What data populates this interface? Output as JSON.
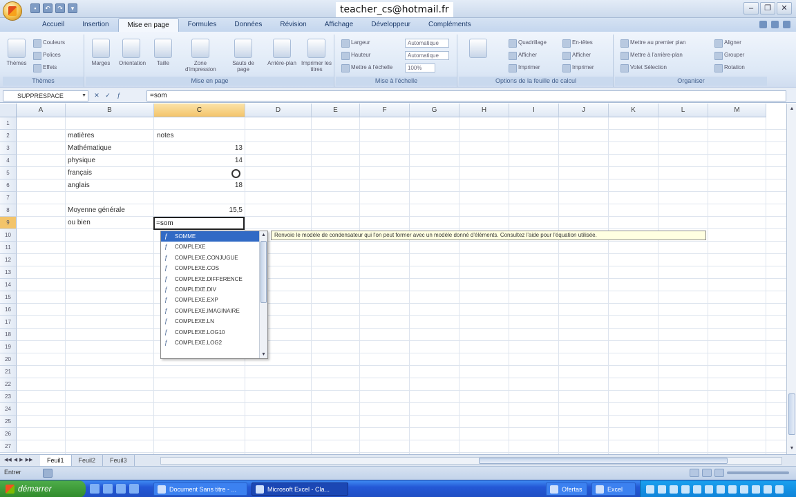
{
  "window": {
    "title": "teacher_cs@hotmail.fr",
    "controls": [
      "–",
      "❐",
      "✕"
    ]
  },
  "ribbon": {
    "tabs": [
      "Accueil",
      "Insertion",
      "Mise en page",
      "Formules",
      "Données",
      "Révision",
      "Affichage",
      "Développeur",
      "Compléments"
    ],
    "active_tab": "Mise en page",
    "groups": [
      "Thèmes",
      "Mise en page",
      "Mise à l'échelle",
      "Options de la feuille de calcul",
      "Organiser"
    ],
    "buttons": [
      "Thèmes",
      "Marges",
      "Orientation",
      "Taille",
      "Zone d'impression",
      "Sauts de page",
      "Arrière-plan",
      "Imprimer les titres"
    ],
    "small_items": [
      "Couleurs",
      "Polices",
      "Effets",
      "Largeur",
      "Hauteur",
      "Mettre à l'échelle",
      "Quadrillage",
      "Afficher",
      "Imprimer",
      "En-têtes",
      "Afficher",
      "Imprimer",
      "Mettre au premier plan",
      "Mettre à l'arrière-plan",
      "Volet Sélection",
      "Aligner",
      "Grouper",
      "Rotation"
    ],
    "fields": [
      "Automatique",
      "Automatique",
      "100%"
    ]
  },
  "formula_bar": {
    "name_box": "SUPPRESPACE",
    "content": "=som"
  },
  "columns": [
    "A",
    "B",
    "C",
    "D",
    "E",
    "F",
    "G",
    "H",
    "I",
    "J",
    "K",
    "L",
    "M"
  ],
  "selected_column": "C",
  "rows": [
    "1",
    "2",
    "3",
    "4",
    "5",
    "6",
    "7",
    "8",
    "9",
    "10",
    "11",
    "12",
    "13",
    "14",
    "15",
    "16",
    "17",
    "18",
    "19",
    "20",
    "21",
    "22",
    "23",
    "24",
    "25",
    "26",
    "27"
  ],
  "selected_row": "9",
  "cells": {
    "b2": "matières",
    "c2": "notes",
    "b3": "Mathématique",
    "c3": "13",
    "b4": "physique",
    "c4": "14",
    "b5": "français",
    "b6": "anglais",
    "c6": "18",
    "b8": "Moyenne générale",
    "c8": "15,5",
    "b9": "ou bien",
    "c9": "=som"
  },
  "autocomplete": {
    "items": [
      "SOMME",
      "COMPLEXE",
      "COMPLEXE.CONJUGUE",
      "COMPLEXE.COS",
      "COMPLEXE.DIFFERENCE",
      "COMPLEXE.DIV",
      "COMPLEXE.EXP",
      "COMPLEXE.IMAGINAIRE",
      "COMPLEXE.LN",
      "COMPLEXE.LOG10",
      "COMPLEXE.LOG2"
    ],
    "selected": "SOMME",
    "tooltip": "Renvoie le modèle de condensateur qui l'on peut former avec un modèle donné d'éléments. Consultez l'aide pour l'équation utilisée."
  },
  "sheets": [
    "Feuil1",
    "Feuil2",
    "Feuil3"
  ],
  "active_sheet": "Feuil1",
  "status": {
    "mode": "Entrer"
  },
  "taskbar": {
    "start": "démarrer",
    "tasks": [
      "Document Sans titre - ...",
      "Microsoft Excel - Cla...",
      "Ofertas",
      "Excel"
    ]
  }
}
